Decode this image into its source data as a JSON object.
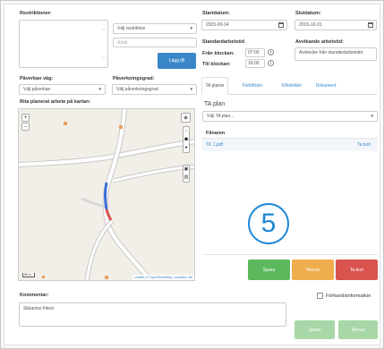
{
  "restrictions": {
    "label": "Restriktioner:",
    "select": "Välj restriktion",
    "amount_placeholder": "Antal",
    "add_button": "Lägg till"
  },
  "dates": {
    "start_label": "Startdatum:",
    "start_value": "2015-09-14",
    "end_label": "Slutdatum:",
    "end_value": "2015-10-31",
    "standard_label": "Standardarbetstid",
    "from_label": "Från klockan:",
    "from_value": "07:00",
    "to_label": "Till klockan:",
    "to_value": "16:00",
    "deviating_label": "Avvikande arbetstid:",
    "deviating_value": "Avvikelse från standardarbetstid"
  },
  "road": {
    "affected_label": "Påverkan väg:",
    "affected_select": "Välj påverkan",
    "degree_label": "Påverkningsgrad:",
    "degree_select": "Välj påverkningsgrad"
  },
  "map": {
    "label": "Rita planerat arbete på kartan:",
    "zoom_in": "+",
    "zoom_out": "−",
    "scale": "50 m",
    "attribution": "Leaflet | © OpenStreetMap | contribut. sfd"
  },
  "tabs": [
    {
      "label": "TA planer"
    },
    {
      "label": "Förbiföder"
    },
    {
      "label": "Effektilder"
    },
    {
      "label": "Dokument"
    }
  ],
  "ta_panel": {
    "select": "Välj TA plan...",
    "heading": "TA plan",
    "column_filename": "Filnamn",
    "file_name": "TK 1.pdf",
    "remove_link": "Ta bort"
  },
  "badge": "5",
  "actions": {
    "save": "Spara",
    "clear": "Rensa",
    "delete": "Ta bort"
  },
  "comment": {
    "label": "Kommentar:",
    "value": "Skkanios fritext",
    "pre_info_label": "Förhandsinformation"
  },
  "footer_actions": {
    "save": "Spara",
    "clear": "Rensa"
  },
  "colors": {
    "primary": "#3a87c8",
    "success": "#5cb85c",
    "warning": "#f0ad4e",
    "danger": "#d9534f",
    "badge": "#1e88d6"
  }
}
